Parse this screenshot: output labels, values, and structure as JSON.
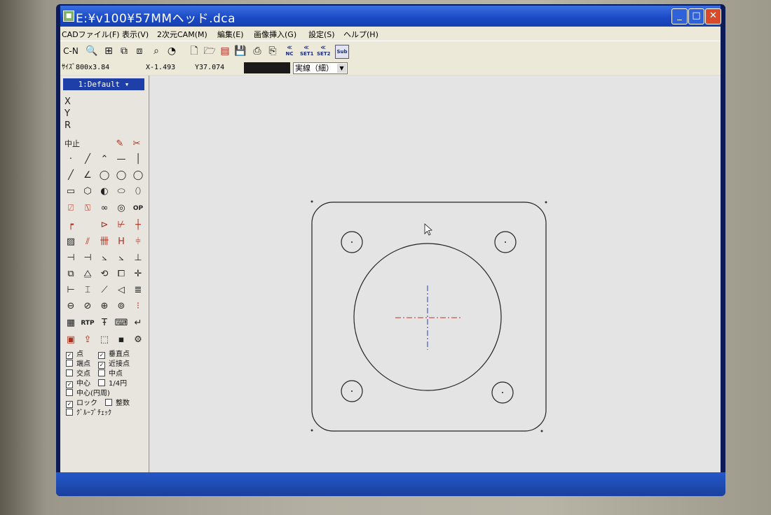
{
  "window": {
    "title": "E:¥v100¥57MMヘッド.dca",
    "app_icon": "cad-app-icon",
    "minimize_icon": "minimize-icon",
    "maximize_icon": "maximize-icon",
    "close_icon": "close-icon"
  },
  "menu": {
    "items": [
      "CADファイル(F)",
      "表示(V)",
      "2次元CAM(M)",
      "編集(E)",
      "画像挿入(G)",
      "設定(S)",
      "ヘルプ(H)"
    ]
  },
  "toolbar": {
    "cn_label": "C-N",
    "nc_label": "NC",
    "set1_label": "SET1",
    "set2_label": "SET2",
    "sub_label": "Sub"
  },
  "status": {
    "size_readout": "ｻｲｽﾞ800x3.84",
    "x_readout": "X-1.493",
    "y_readout": "Y37.074",
    "line_type": "実線（細）"
  },
  "panel": {
    "layer": "1:Default",
    "coord_x": "X",
    "coord_y": "Y",
    "coord_r": "R",
    "stop_label": "中止",
    "op_label": "OP",
    "rtp_label": "RTP",
    "snaps": [
      {
        "label": "点",
        "checked": true
      },
      {
        "label": "垂直点",
        "checked": true
      },
      {
        "label": "端点",
        "checked": false
      },
      {
        "label": "近接点",
        "checked": true
      },
      {
        "label": "交点",
        "checked": false
      },
      {
        "label": "中点",
        "checked": false
      },
      {
        "label": "中心",
        "checked": true
      },
      {
        "label": "1/4円",
        "checked": false
      },
      {
        "label": "中心(円周)",
        "checked": false
      },
      {
        "label": "ロック",
        "checked": true
      },
      {
        "label": "整数",
        "checked": false
      },
      {
        "label": "ｸﾞﾙｰﾌﾟﾁｪｯｸ",
        "checked": false
      }
    ]
  },
  "colors": {
    "title_bar": "#1a49c4",
    "centerline_h": "#c03020",
    "centerline_v": "#2a3ab0",
    "drawing_line": "#222222"
  }
}
